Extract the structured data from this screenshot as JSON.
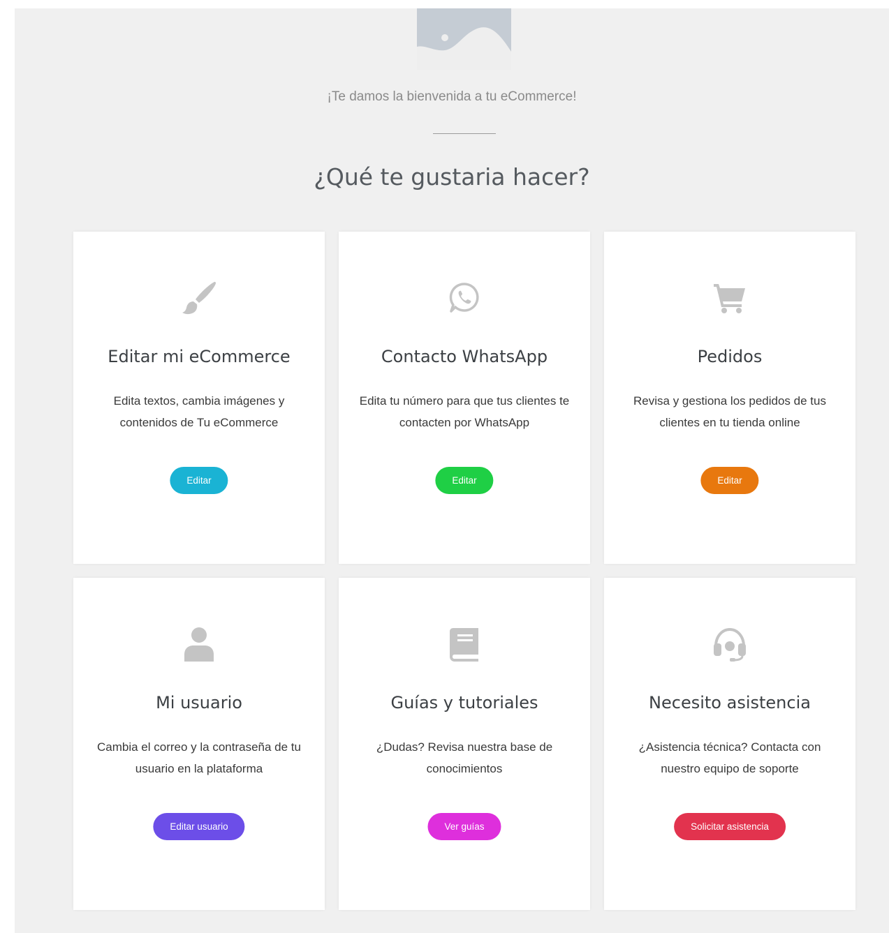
{
  "header": {
    "welcome": "¡Te damos la bienvenida a tu eCommerce!",
    "question": "¿Qué te gustaria hacer?"
  },
  "cards": [
    {
      "icon": "paintbrush-icon",
      "title": "Editar mi eCommerce",
      "desc": "Edita textos, cambia imágenes y contenidos de Tu eCommerce",
      "button": "Editar",
      "color": "#1ab3d4"
    },
    {
      "icon": "whatsapp-icon",
      "title": "Contacto WhatsApp",
      "desc": "Edita tu número para que tus clientes te contacten por WhatsApp",
      "button": "Editar",
      "color": "#1fcf45"
    },
    {
      "icon": "shopping-cart-icon",
      "title": "Pedidos",
      "desc": "Revisa y gestiona los pedidos de tus clientes en tu tienda online",
      "button": "Editar",
      "color": "#e8780e"
    },
    {
      "icon": "user-icon",
      "title": "Mi usuario",
      "desc": "Cambia el correo y la contraseña de tu usuario en la plataforma",
      "button": "Editar usuario",
      "color": "#6c4ee8"
    },
    {
      "icon": "book-icon",
      "title": "Guías y tutoriales",
      "desc": "¿Dudas? Revisa nuestra base de conocimientos",
      "button": "Ver guías",
      "color": "#de2fdc"
    },
    {
      "icon": "headset-icon",
      "title": "Necesito asistencia",
      "desc": "¿Asistencia técnica? Contacta con nuestro equipo de soporte",
      "button": "Solicitar asistencia",
      "color": "#e2334e"
    }
  ]
}
